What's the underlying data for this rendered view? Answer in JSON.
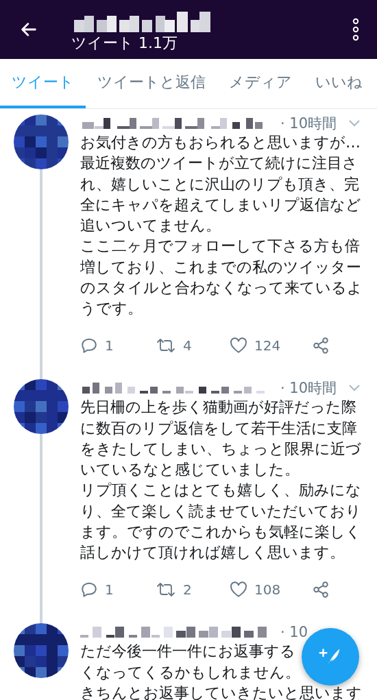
{
  "header": {
    "subtitle": "ツイート 1.1万"
  },
  "tabs": [
    {
      "label": "ツイート",
      "selected": true
    },
    {
      "label": "ツイートと返信",
      "selected": false
    },
    {
      "label": "メディア",
      "selected": false
    },
    {
      "label": "いいね",
      "selected": false
    }
  ],
  "tweets": [
    {
      "time": "· 10時間",
      "lines": [
        "お気付きの方もおられると思いますが…",
        "最近複数のツイートが立て続けに注目さ",
        "れ、嬉しいことに沢山のリプも頂き、完",
        "全にキャパを超えてしまいリプ返信など",
        "追いついてません。",
        "ここ二ヶ月でフォローして下さる方も倍",
        "増しており、これまでの私のツイッター",
        "のスタイルと合わなくなって来ているよ",
        "うです。"
      ],
      "replies": "1",
      "retweets": "4",
      "likes": "124"
    },
    {
      "time": "· 10時間",
      "lines": [
        "先日柵の上を歩く猫動画が好評だった際",
        "に数百のリプ返信をして若干生活に支障",
        "をきたしてしまい、ちょっと限界に近づ",
        "いているなと感じていました。",
        "リプ頂くことはとても嬉しく、励みにな",
        "り、全て楽しく読ませていただいており",
        "ます。ですのでこれからも気軽に楽しく",
        "話しかけて頂ければ嬉しく思います。"
      ],
      "replies": "1",
      "retweets": "2",
      "likes": "108"
    },
    {
      "time": "· 10",
      "lines": [
        "ただ今後一件一件にお返事する",
        "くなってくるかもしれません。",
        "きちんとお返事していきたいと思います"
      ]
    }
  ]
}
